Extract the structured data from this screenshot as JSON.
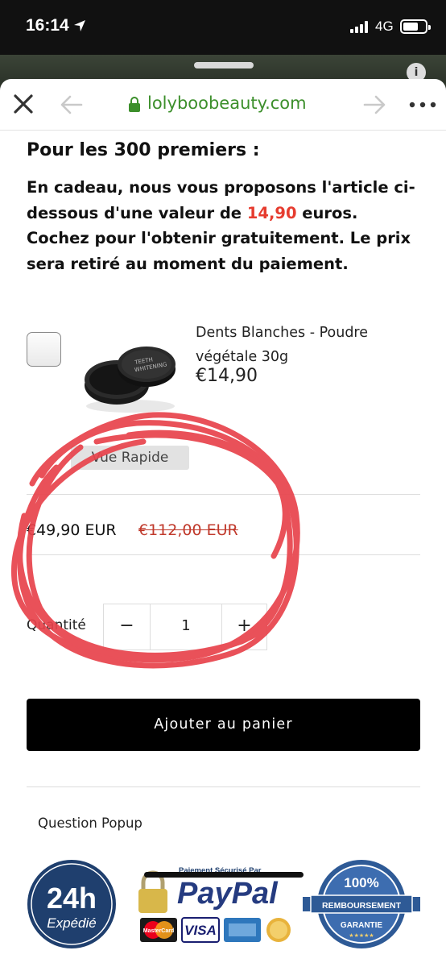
{
  "status_bar": {
    "time": "16:14",
    "network": "4G",
    "icons": [
      "location-arrow-icon",
      "signal-icon",
      "battery-icon"
    ]
  },
  "browser": {
    "url": "lolyboobeauty.com",
    "icons": [
      "close-icon",
      "back-arrow-icon",
      "lock-icon",
      "forward-arrow-icon",
      "more-icon"
    ],
    "url_color": "#3c8f2b"
  },
  "promo": {
    "title": "Pour les 300 premiers :",
    "text_before": "En cadeau, nous vous proposons l'article ci-dessous d'une valeur de ",
    "highlight": "14,90",
    "text_after": " euros. Cochez pour l'obtenir gratuitement. Le prix sera retiré au moment du paiement.",
    "highlight_color": "#e63c2f"
  },
  "gift_product": {
    "name": "Dents Blanches - Poudre végétale 30g",
    "price": "€14,90",
    "quick_view": "Vue Rapide",
    "checked": false
  },
  "pricing": {
    "current": "€49,90 EUR",
    "original": "€112,00 EUR"
  },
  "quantity": {
    "label": "Quantité",
    "minus": "−",
    "value": "1",
    "plus": "+"
  },
  "cart": {
    "add_label": "Ajouter au panier"
  },
  "question_popup": "Question Popup",
  "badges": {
    "shipping_top": "24h",
    "shipping_bottom": "Expédié",
    "paypal_caption": "Paiement Sécurisé Par",
    "paypal_name": "PayPal",
    "card_visa": "VISA",
    "card_mastercard": "MasterCard",
    "refund_percent": "100%",
    "refund_title": "REMBOURSEMENT",
    "refund_sub": "GARANTIE",
    "refund_stars": "★★★★★"
  },
  "colors": {
    "scribble": "#e8434c",
    "button_bg": "#000000",
    "price_old": "#c0392b",
    "badge_navy": "#1f3f6e"
  }
}
